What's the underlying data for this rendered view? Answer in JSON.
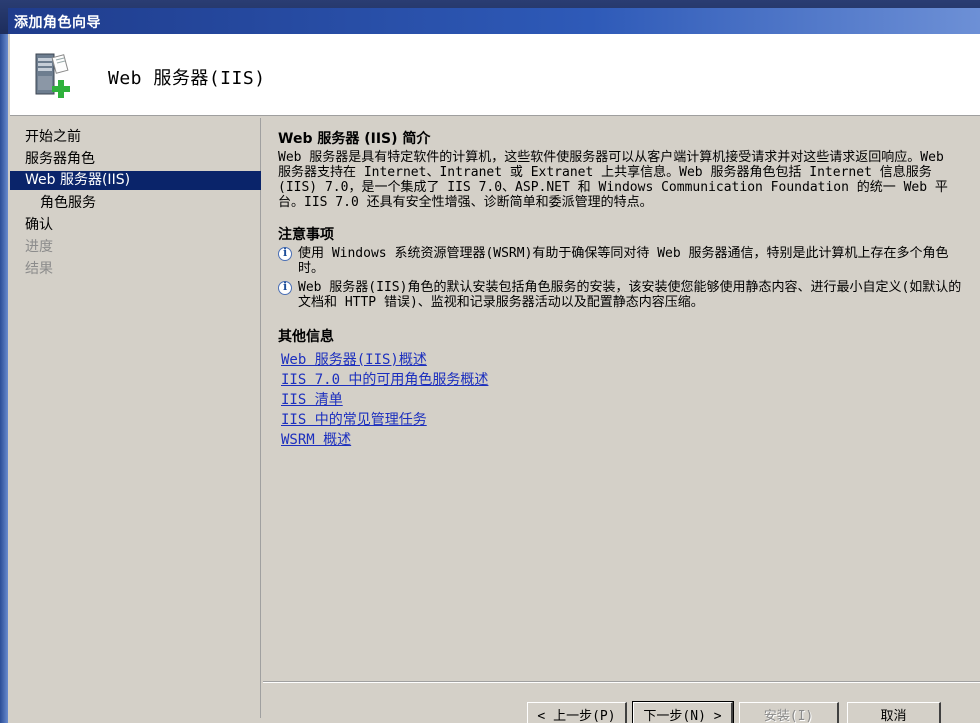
{
  "window": {
    "title": "添加角色向导"
  },
  "header": {
    "title": "Web 服务器(IIS)",
    "icon": "server-role-add-icon"
  },
  "sidebar": {
    "items": [
      {
        "label": "开始之前",
        "state": "normal"
      },
      {
        "label": "服务器角色",
        "state": "normal"
      },
      {
        "label": "Web 服务器(IIS)",
        "state": "selected"
      },
      {
        "label": "角色服务",
        "state": "normal"
      },
      {
        "label": "确认",
        "state": "normal"
      },
      {
        "label": "进度",
        "state": "disabled"
      },
      {
        "label": "结果",
        "state": "disabled"
      }
    ]
  },
  "main": {
    "intro_heading": "Web 服务器 (IIS) 简介",
    "intro_text": "Web 服务器是具有特定软件的计算机，这些软件使服务器可以从客户端计算机接受请求并对这些请求返回响应。Web 服务器支持在 Internet、Intranet 或 Extranet 上共享信息。Web 服务器角色包括 Internet 信息服务(IIS) 7.0，是一个集成了 IIS 7.0、ASP.NET 和 Windows Communication Foundation 的统一 Web 平台。IIS 7.0 还具有安全性增强、诊断简单和委派管理的特点。",
    "notes_heading": "注意事项",
    "notes": [
      "使用 Windows 系统资源管理器(WSRM)有助于确保等同对待 Web 服务器通信，特别是此计算机上存在多个角色时。",
      "Web 服务器(IIS)角色的默认安装包括角色服务的安装，该安装使您能够使用静态内容、进行最小自定义(如默认的文档和 HTTP 错误)、监视和记录服务器活动以及配置静态内容压缩。"
    ],
    "more_heading": "其他信息",
    "links": [
      "Web 服务器(IIS)概述",
      "IIS 7.0 中的可用角色服务概述",
      "IIS 清单",
      "IIS 中的常见管理任务",
      "WSRM 概述"
    ]
  },
  "footer": {
    "prev_label": "< 上一步(P)",
    "next_label": "下一步(N) >",
    "install_label": "安装(I)",
    "cancel_label": "取消"
  },
  "colors": {
    "selection": "#0a246a",
    "link": "#1c2fbe",
    "title_gradient_start": "#1f3c8c"
  }
}
